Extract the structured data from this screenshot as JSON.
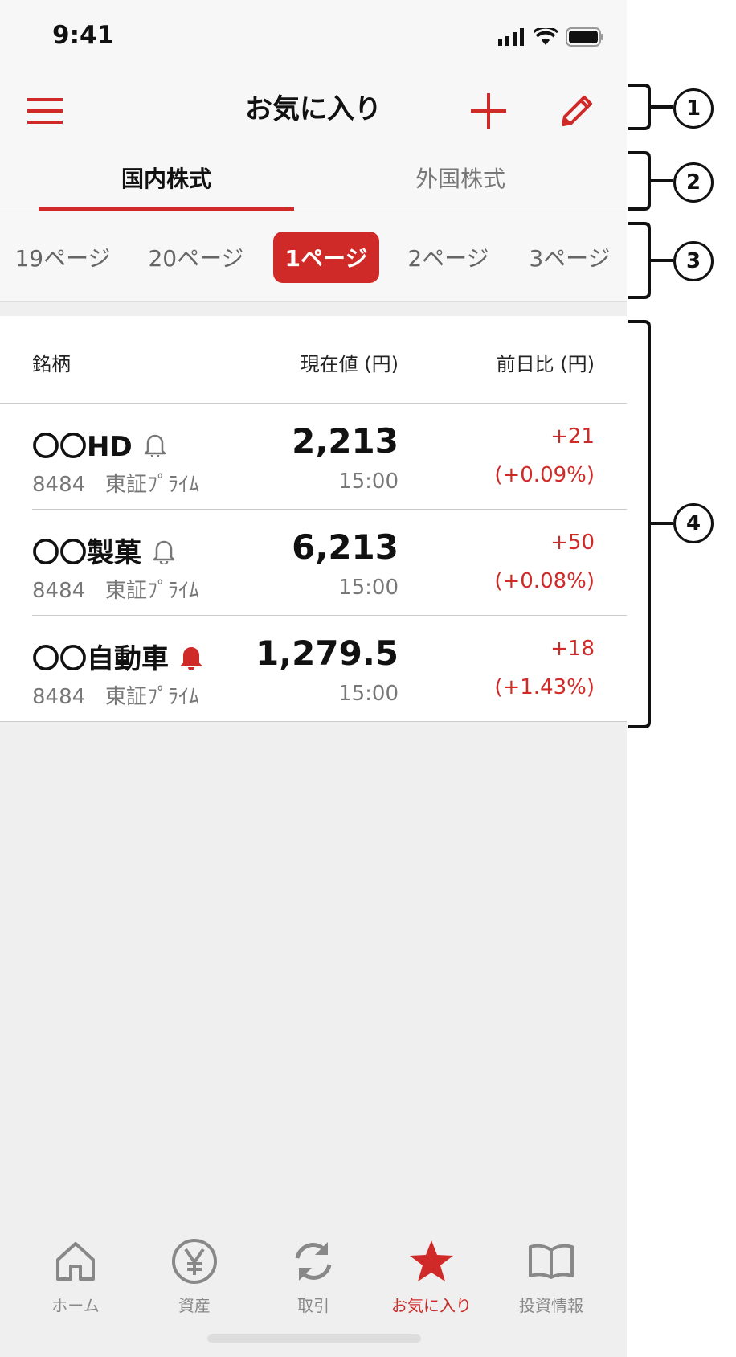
{
  "status": {
    "time": "9:41"
  },
  "header": {
    "title": "お気に入り"
  },
  "tabs": [
    {
      "label": "国内株式"
    },
    {
      "label": "外国株式"
    }
  ],
  "pages": [
    {
      "label": "19ページ"
    },
    {
      "label": "20ページ"
    },
    {
      "label": "1ページ"
    },
    {
      "label": "2ページ"
    },
    {
      "label": "3ページ"
    }
  ],
  "list": {
    "headers": {
      "name": "銘柄",
      "price": "現在値 (円)",
      "change": "前日比 (円)"
    },
    "rows": [
      {
        "name": "〇〇HD",
        "code": "8484",
        "market": "東証ﾌﾟﾗｲﾑ",
        "price": "2,213",
        "time": "15:00",
        "change": "+21",
        "change_pct": "(+0.09%)",
        "alert": "bell-outline-icon"
      },
      {
        "name": "〇〇製菓",
        "code": "8484",
        "market": "東証ﾌﾟﾗｲﾑ",
        "price": "6,213",
        "time": "15:00",
        "change": "+50",
        "change_pct": "(+0.08%)",
        "alert": "bell-outline-icon"
      },
      {
        "name": "〇〇自動車",
        "code": "8484",
        "market": "東証ﾌﾟﾗｲﾑ",
        "price": "1,279.5",
        "time": "15:00",
        "change": "+18",
        "change_pct": "(+1.43%)",
        "alert": "bell-filled-icon"
      }
    ]
  },
  "bottom_nav": [
    {
      "label": "ホーム",
      "icon": "home-icon"
    },
    {
      "label": "資産",
      "icon": "yen-icon"
    },
    {
      "label": "取引",
      "icon": "refresh-icon"
    },
    {
      "label": "お気に入り",
      "icon": "star-icon"
    },
    {
      "label": "投資情報",
      "icon": "book-icon"
    }
  ],
  "callouts": [
    "1",
    "2",
    "3",
    "4"
  ],
  "colors": {
    "accent": "#cf2a27"
  }
}
